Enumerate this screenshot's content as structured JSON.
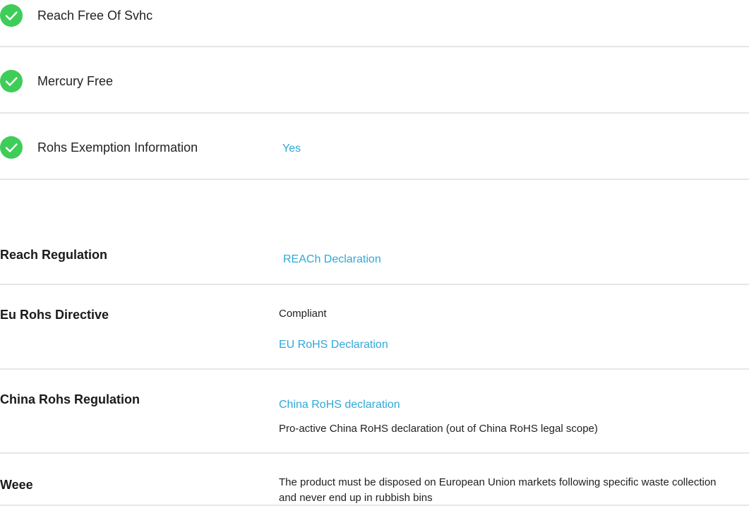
{
  "checklist": [
    {
      "label": "Reach Free Of Svhc",
      "icon": "check-icon"
    },
    {
      "label": "Mercury Free",
      "icon": "check-icon"
    },
    {
      "label": "Rohs Exemption Information",
      "icon": "check-icon",
      "value": "Yes"
    }
  ],
  "regulations": {
    "reach": {
      "label": "Reach Regulation",
      "link": "REACh Declaration"
    },
    "eu_rohs": {
      "label": "Eu Rohs Directive",
      "status": "Compliant",
      "link": "EU RoHS Declaration"
    },
    "china_rohs": {
      "label": "China Rohs Regulation",
      "link": "China RoHS declaration",
      "note": "Pro-active China RoHS declaration (out of China RoHS legal scope)"
    },
    "weee": {
      "label": "Weee",
      "note": "The product must be disposed on European Union markets following specific waste collection and never end up in rubbish bins"
    }
  },
  "colors": {
    "check_green": "#3dcd58",
    "link_blue": "#2ea8d8",
    "divider": "#e6e6e6"
  }
}
